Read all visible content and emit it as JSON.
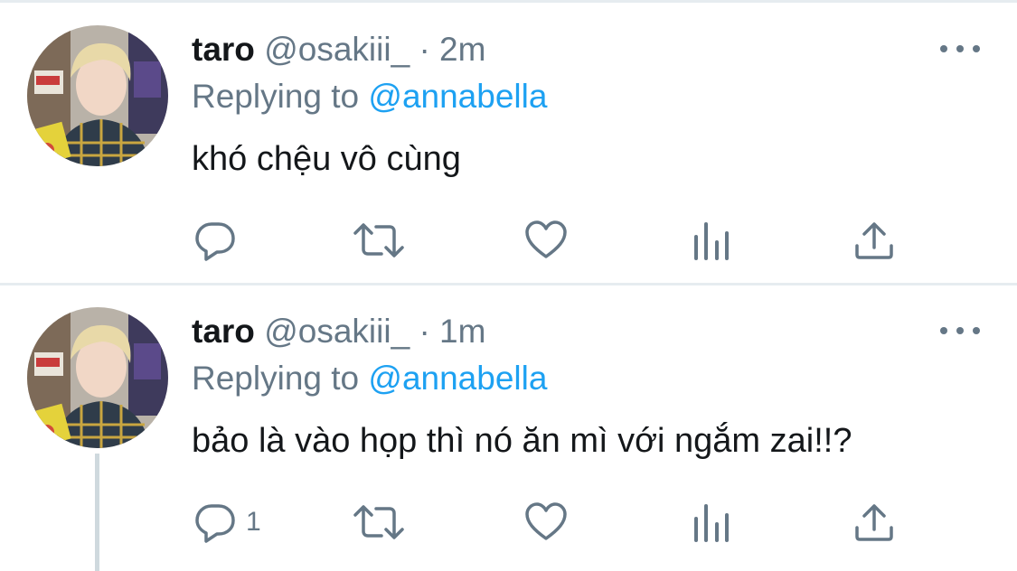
{
  "tweets": [
    {
      "display_name": "taro",
      "handle": "@osakiii_",
      "separator": "·",
      "time": "2m",
      "replying_prefix": "Replying to",
      "replying_to": "@annabella",
      "text": "khó chệu vô cùng",
      "reply_count": "",
      "avatar_icon": "user-avatar-photo"
    },
    {
      "display_name": "taro",
      "handle": "@osakiii_",
      "separator": "·",
      "time": "1m",
      "replying_prefix": "Replying to",
      "replying_to": "@annabella",
      "text": "bảo là vào họp thì nó ăn mì với ngắm zai!!?",
      "reply_count": "1",
      "avatar_icon": "user-avatar-photo"
    }
  ],
  "icons": {
    "reply": "reply-icon",
    "retweet": "retweet-icon",
    "like": "heart-icon",
    "stats": "analytics-icon",
    "share": "share-icon",
    "more": "more-options-icon"
  },
  "colors": {
    "link_blue": "#1da1f2",
    "secondary_text": "#657786",
    "primary_text": "#14171a",
    "divider": "#e6ecf0",
    "thread_line": "#cfd9de"
  }
}
